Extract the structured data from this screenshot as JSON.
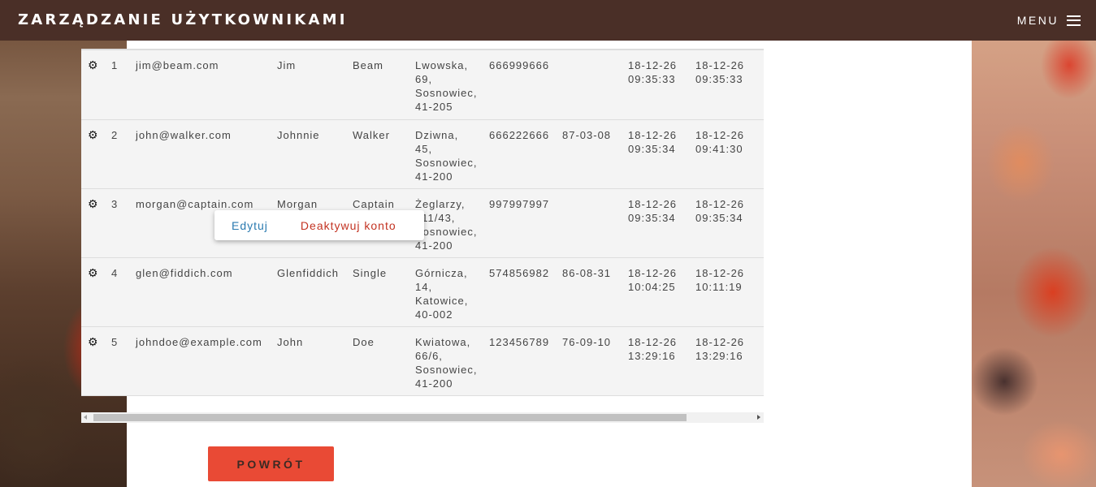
{
  "app": {
    "title": "ZARZĄDZANIE UŻYTKOWNIKAMI",
    "menu_label": "MENU"
  },
  "table": {
    "rows": [
      {
        "id": "1",
        "email": "jim@beam.com",
        "first": "Jim",
        "last": "Beam",
        "address": [
          "Lwowska,",
          "69,",
          "Sosnowiec,",
          "41-205"
        ],
        "phone": "666999666",
        "birth": "",
        "created": [
          "18-12-26",
          "09:35:33"
        ],
        "modified": [
          "18-12-26",
          "09:35:33"
        ]
      },
      {
        "id": "2",
        "email": "john@walker.com",
        "first": "Johnnie",
        "last": "Walker",
        "address": [
          "Dziwna,",
          "45,",
          "Sosnowiec,",
          "41-200"
        ],
        "phone": "666222666",
        "birth": "87-03-08",
        "created": [
          "18-12-26",
          "09:35:34"
        ],
        "modified": [
          "18-12-26",
          "09:41:30"
        ]
      },
      {
        "id": "3",
        "email": "morgan@captain.com",
        "first": "Morgan",
        "last": "Captain",
        "address": [
          "Żeglarzy,",
          "211/43,",
          "Sosnowiec,",
          "41-200"
        ],
        "phone": "997997997",
        "birth": "",
        "created": [
          "18-12-26",
          "09:35:34"
        ],
        "modified": [
          "18-12-26",
          "09:35:34"
        ]
      },
      {
        "id": "4",
        "email": "glen@fiddich.com",
        "first": "Glenfiddich",
        "last": "Single",
        "address": [
          "Górnicza,",
          "14,",
          "Katowice,",
          "40-002"
        ],
        "phone": "574856982",
        "birth": "86-08-31",
        "created": [
          "18-12-26",
          "10:04:25"
        ],
        "modified": [
          "18-12-26",
          "10:11:19"
        ]
      },
      {
        "id": "5",
        "email": "johndoe@example.com",
        "first": "John",
        "last": "Doe",
        "address": [
          "Kwiatowa,",
          "66/6,",
          "Sosnowiec,",
          "41-200"
        ],
        "phone": "123456789",
        "birth": "76-09-10",
        "created": [
          "18-12-26",
          "13:29:16"
        ],
        "modified": [
          "18-12-26",
          "13:29:16"
        ]
      }
    ]
  },
  "popup": {
    "edit_label": "Edytuj",
    "deactivate_label": "Deaktywuj konto"
  },
  "back_button": "POWRÓT",
  "colors": {
    "navbar": "#4a2f27",
    "button": "#e94a35",
    "edit_link": "#2a7ab0",
    "deactivate_link": "#c33322"
  },
  "icons": {
    "row_action": "gear-icon",
    "menu": "hamburger-icon"
  }
}
